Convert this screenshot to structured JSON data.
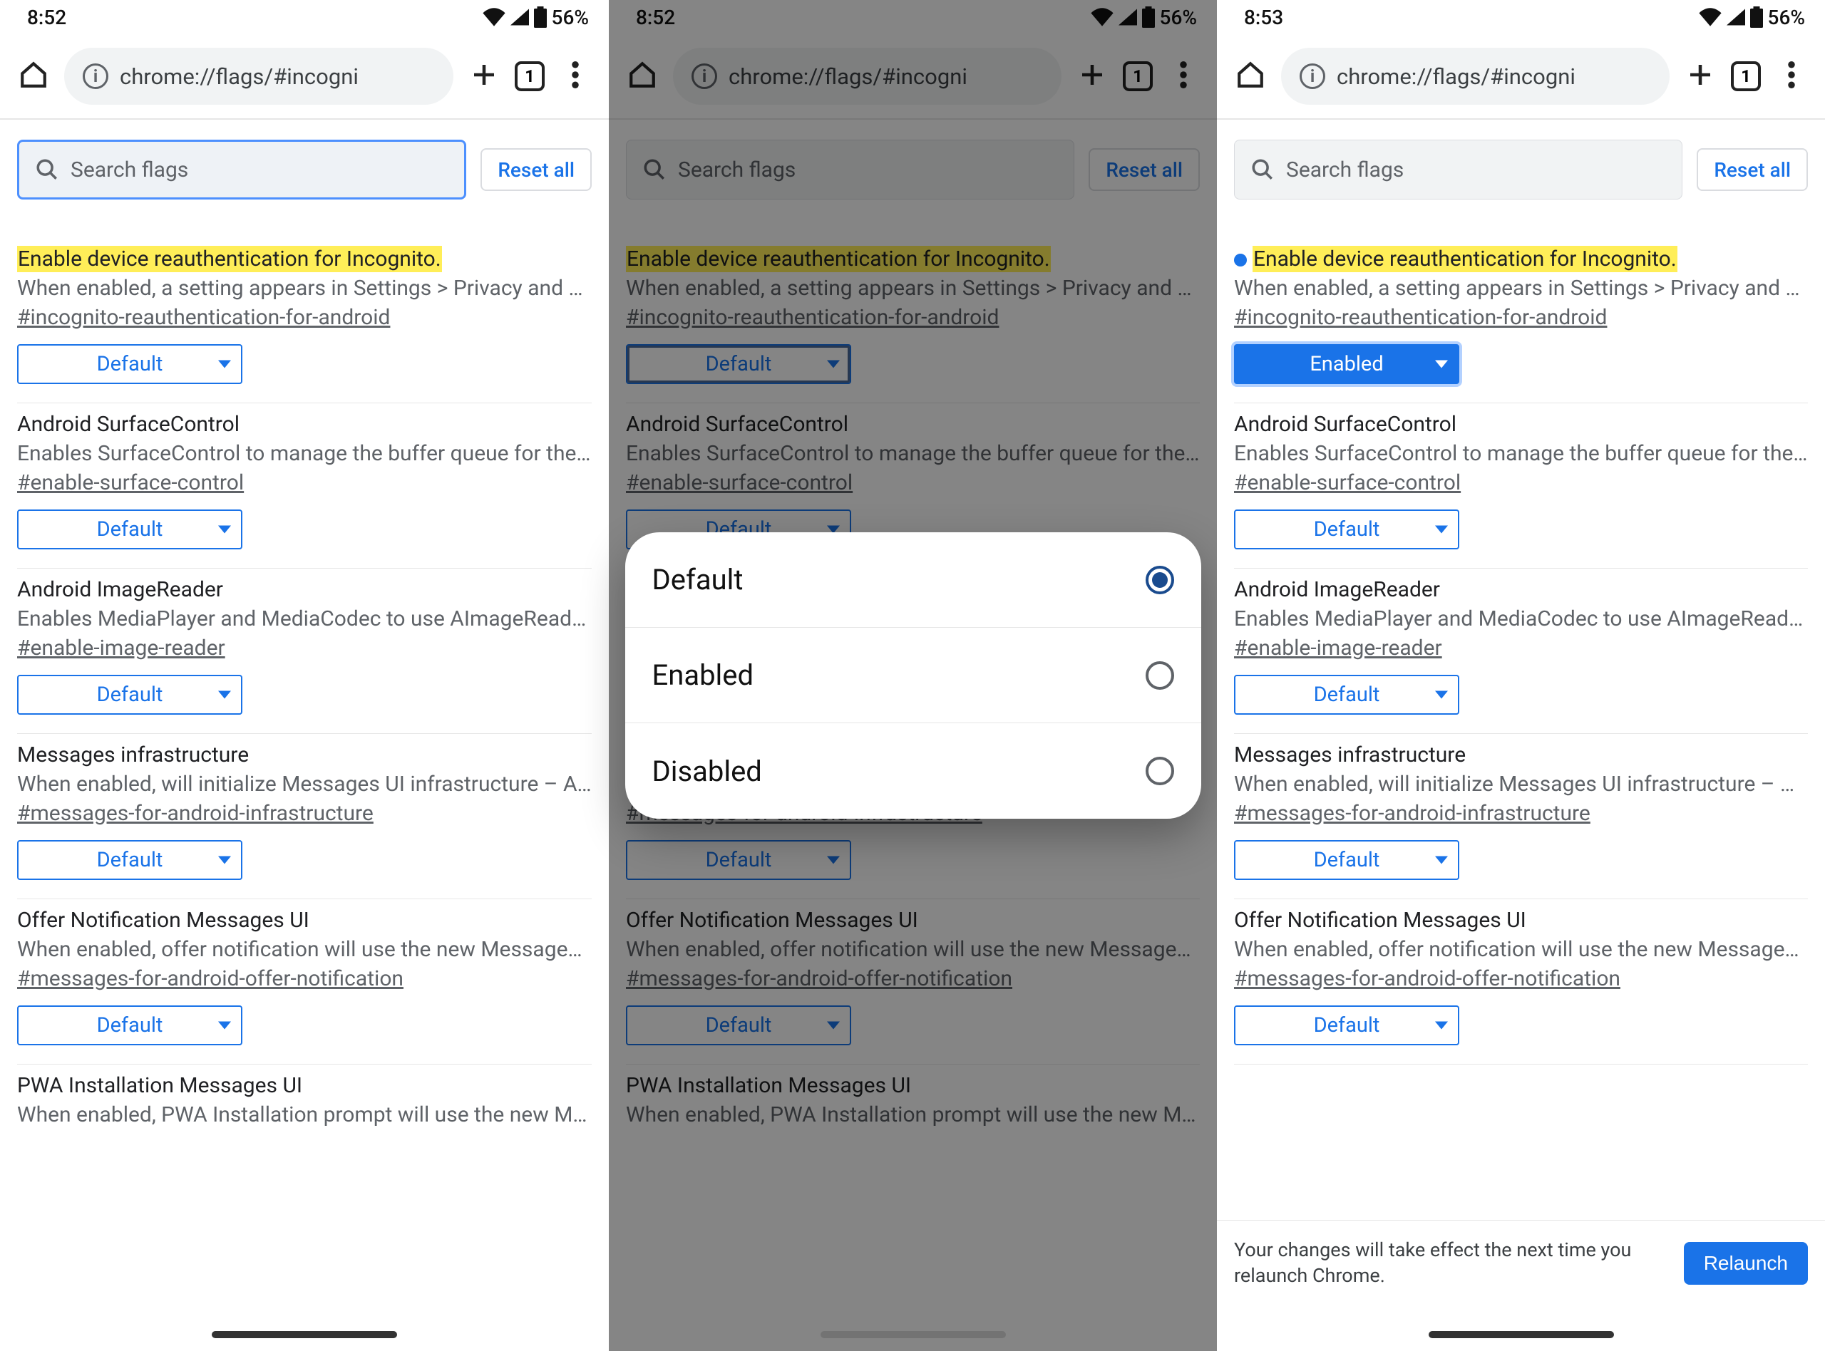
{
  "status": {
    "time_a": "8:52",
    "time_b": "8:52",
    "time_c": "8:53",
    "batt": "56%"
  },
  "omnibox": {
    "url": "chrome://flags/#incogni",
    "tabcount": "1"
  },
  "search": {
    "placeholder": "Search flags",
    "reset": "Reset all"
  },
  "select_values": {
    "default": "Default",
    "enabled": "Enabled"
  },
  "modal": {
    "options": [
      "Default",
      "Enabled",
      "Disabled"
    ]
  },
  "relaunch": {
    "msg": "Your changes will take effect the next time you relaunch Chrome.",
    "btn": "Relaunch"
  },
  "flags": [
    {
      "title": "Enable device reauthentication for Incognito.",
      "highlight": true,
      "desc": "When enabled, a setting appears in Settings > Privacy and Se…",
      "anchor": "#incognito-reauthentication-for-android"
    },
    {
      "title": "Android SurfaceControl",
      "desc": "Enables SurfaceControl to manage the buffer queue for the …",
      "anchor": "#enable-surface-control"
    },
    {
      "title": "Android ImageReader",
      "desc": "Enables MediaPlayer and MediaCodec to use AImageReader…",
      "anchor": "#enable-image-reader"
    },
    {
      "title": "Messages infrastructure",
      "desc": "When enabled, will initialize Messages UI infrastructure – An…",
      "anchor": "#messages-for-android-infrastructure"
    },
    {
      "title": "Offer Notification Messages UI",
      "desc": "When enabled, offer notification will use the new Messages …",
      "anchor": "#messages-for-android-offer-notification"
    },
    {
      "title": "PWA Installation Messages UI",
      "desc": "When enabled, PWA Installation prompt will use the new Mes…",
      "anchor": ""
    }
  ]
}
